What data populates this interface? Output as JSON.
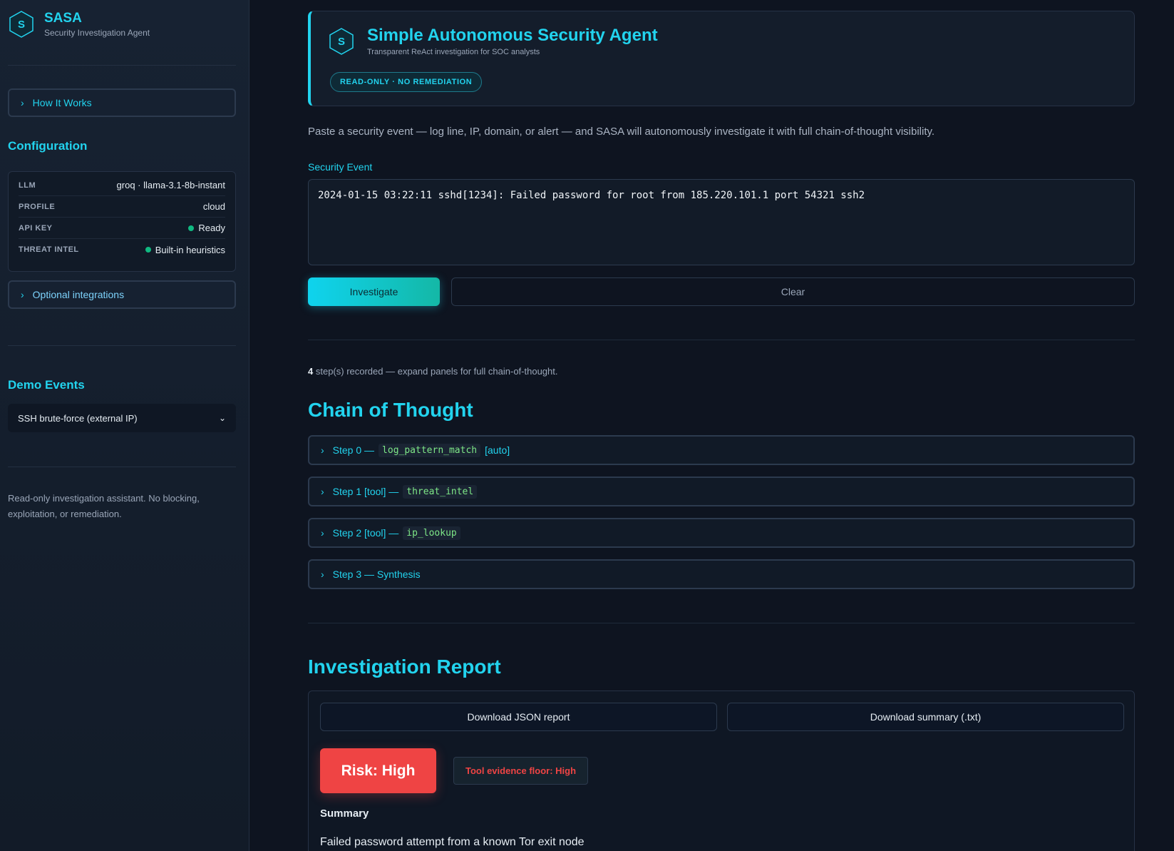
{
  "sidebar": {
    "brand": {
      "letter": "S",
      "title": "SASA",
      "subtitle": "Security Investigation Agent"
    },
    "how_it_works": "How It Works",
    "config_heading": "Configuration",
    "config": [
      {
        "key": "LLM",
        "value": "groq · llama-3.1-8b-instant",
        "status": false
      },
      {
        "key": "PROFILE",
        "value": "cloud",
        "status": false
      },
      {
        "key": "API KEY",
        "value": "Ready",
        "status": true
      },
      {
        "key": "THREAT INTEL",
        "value": "Built-in heuristics",
        "status": true
      }
    ],
    "optional_integrations": "Optional integrations",
    "demo_heading": "Demo Events",
    "demo_selected": "SSH brute-force (external IP)",
    "footer": "Read-only investigation assistant. No blocking, exploitation, or remediation."
  },
  "hero": {
    "letter": "S",
    "title": "Simple Autonomous Security Agent",
    "subtitle": "Transparent ReAct investigation for SOC analysts",
    "badge": "READ-ONLY · NO REMEDIATION"
  },
  "intro": "Paste a security event — log line, IP, domain, or alert — and SASA will autonomously investigate it with full chain-of-thought visibility.",
  "event": {
    "label": "Security Event",
    "value": "2024-01-15 03:22:11 sshd[1234]: Failed password for root from 185.220.101.1 port 54321 ssh2"
  },
  "buttons": {
    "investigate": "Investigate",
    "clear": "Clear"
  },
  "steps_summary": {
    "count": "4",
    "text": " step(s) recorded — expand panels for full chain-of-thought."
  },
  "chain": {
    "title": "Chain of Thought",
    "steps": [
      {
        "prefix": "Step 0 —",
        "tool": "log_pattern_match",
        "suffix": "[auto]"
      },
      {
        "prefix": "Step 1 [tool] —",
        "tool": "threat_intel",
        "suffix": ""
      },
      {
        "prefix": "Step 2 [tool] —",
        "tool": "ip_lookup",
        "suffix": ""
      },
      {
        "prefix": "Step 3 — Synthesis",
        "tool": "",
        "suffix": ""
      }
    ]
  },
  "report": {
    "title": "Investigation Report",
    "download_json": "Download JSON report",
    "download_txt": "Download summary (.txt)",
    "risk": "Risk: High",
    "evidence_floor": "Tool evidence floor: High",
    "summary_label": "Summary",
    "summary_text": "Failed password attempt from a known Tor exit node"
  },
  "colors": {
    "accent": "#22d3ee",
    "risk": "#ef4444",
    "status_ok": "#10b981"
  }
}
